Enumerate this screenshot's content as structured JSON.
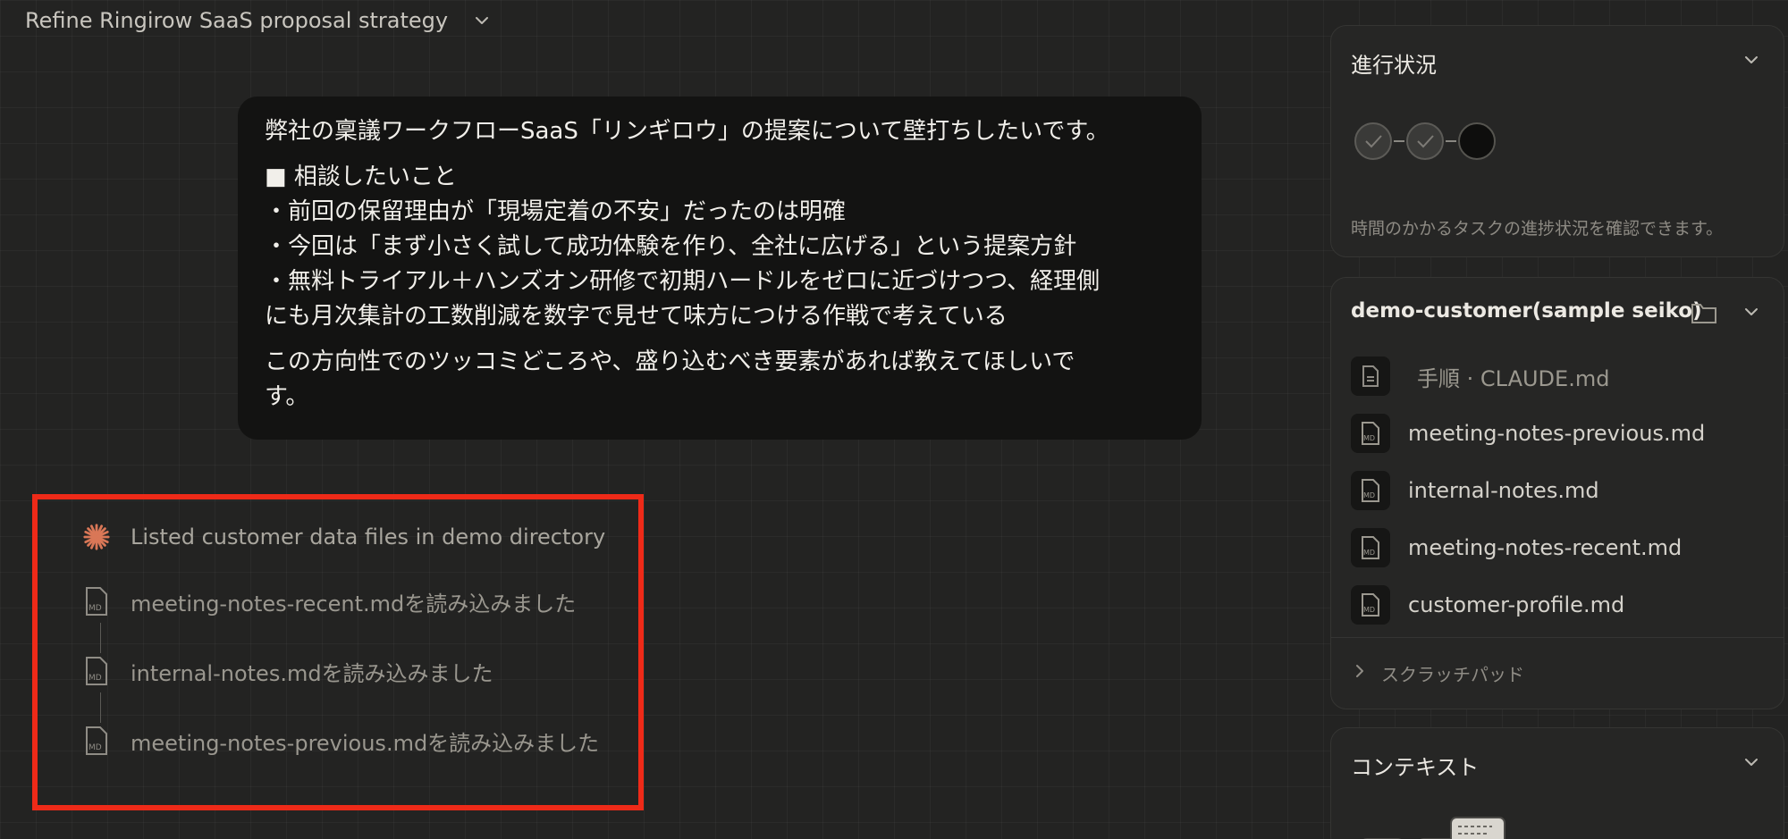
{
  "header": {
    "title": "Refine Ringirow SaaS proposal strategy"
  },
  "message": {
    "line1": "弊社の稟議ワークフローSaaS「リンギロウ」の提案について壁打ちしたいです。",
    "line2": "■ 相談したいこと",
    "line3": "・前回の保留理由が「現場定着の不安」だったのは明確",
    "line4": "・今回は「まず小さく試して成功体験を作り、全社に広げる」という提案方針",
    "line5": "・無料トライアル＋ハンズオン研修で初期ハードルをゼロに近づけつつ、経理側",
    "line6": "にも月次集計の工数削減を数字で見せて味方につける作戦で考えている",
    "line7": "この方向性でのツッコミどころや、盛り込むべき要素があれば教えてほしいで",
    "line8": "す。"
  },
  "activity": {
    "summary": "Listed customer data files in demo directory",
    "steps": [
      {
        "label": "meeting-notes-recent.mdを読み込みました",
        "icon": "md-file-icon"
      },
      {
        "label": "internal-notes.mdを読み込みました",
        "icon": "md-file-icon"
      },
      {
        "label": "meeting-notes-previous.mdを読み込みました",
        "icon": "md-file-icon"
      }
    ],
    "highlight_color": "#ee2a18",
    "accent_color": "#d97757"
  },
  "progress_panel": {
    "title": "進行状況",
    "steps_done": 2,
    "steps_total": 3,
    "note": "時間のかかるタスクの進捗状況を確認できます。"
  },
  "files_panel": {
    "title": "demo-customer(sample seiko)",
    "files": [
      {
        "name": "手順 · CLAUDE.md",
        "icon": "doc-icon"
      },
      {
        "name": "meeting-notes-previous.md",
        "icon": "md-file-icon"
      },
      {
        "name": "internal-notes.md",
        "icon": "md-file-icon"
      },
      {
        "name": "meeting-notes-recent.md",
        "icon": "md-file-icon"
      },
      {
        "name": "customer-profile.md",
        "icon": "md-file-icon"
      }
    ],
    "scratchpad": "スクラッチパッド"
  },
  "context_panel": {
    "title": "コンテキスト"
  }
}
